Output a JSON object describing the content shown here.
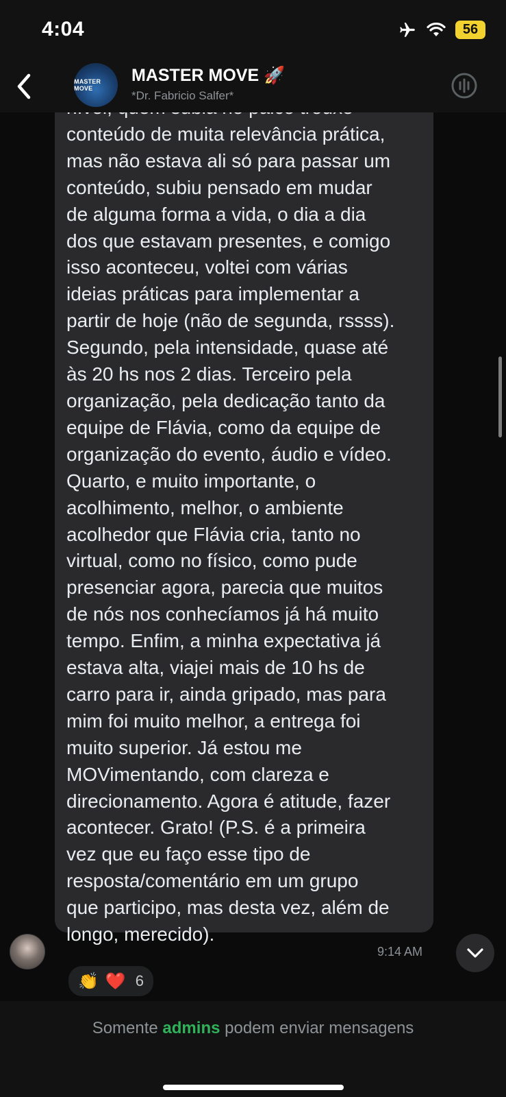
{
  "status_bar": {
    "time": "4:04",
    "battery": "56",
    "icons": [
      "airplane-icon",
      "wifi-icon",
      "battery-icon"
    ]
  },
  "header": {
    "group_name": "MASTER MOVE",
    "group_emoji": "🚀",
    "avatar_text": "MASTER MOVE",
    "subtitle": "*Dr. Fabricio Salfer*"
  },
  "message": {
    "text": "nível, quem subia no palco trouxe\nconteúdo de muita relevância prática,\nmas não estava ali só para passar um\nconteúdo, subiu pensado em mudar\nde alguma forma a vida, o dia a dia\ndos que estavam presentes, e comigo\nisso aconteceu, voltei com várias\nideias práticas para implementar a\npartir de hoje (não de segunda, rssss).\nSegundo, pela intensidade, quase até\nàs 20 hs nos 2 dias. Terceiro pela\norganização, pela dedicação tanto da\nequipe de Flávia, como da equipe de\norganização do evento, áudio e vídeo.\nQuarto, e muito importante, o\nacolhimento, melhor, o ambiente\nacolhedor que Flávia cria, tanto no\nvirtual, como no físico, como pude\npresenciar agora, parecia que muitos\nde nós nos conhecíamos já há muito\ntempo. Enfim, a minha expectativa já\nestava alta, viajei mais de 10 hs de\ncarro para ir, ainda gripado, mas para\nmim foi muito melhor, a entrega foi\nmuito superior. Já estou me\nMOVimentando, com clareza e\ndirecionamento. Agora é atitude, fazer\nacontecer. Grato! (P.S. é a primeira\nvez que eu faço esse tipo de\nresposta/comentário em um grupo\nque participo, mas desta vez, além de\nlongo, merecido).",
    "time": "9:14 AM",
    "reactions": [
      "👏",
      "❤️"
    ],
    "reaction_count": "6"
  },
  "footer": {
    "prefix": "Somente",
    "admins": "admins",
    "suffix": "podem enviar mensagens"
  },
  "colors": {
    "background": "#0b0b0b",
    "bar": "#121212",
    "bubble": "#2a2a2c",
    "accent_green": "#2fb25a",
    "battery": "#f2d22e"
  }
}
